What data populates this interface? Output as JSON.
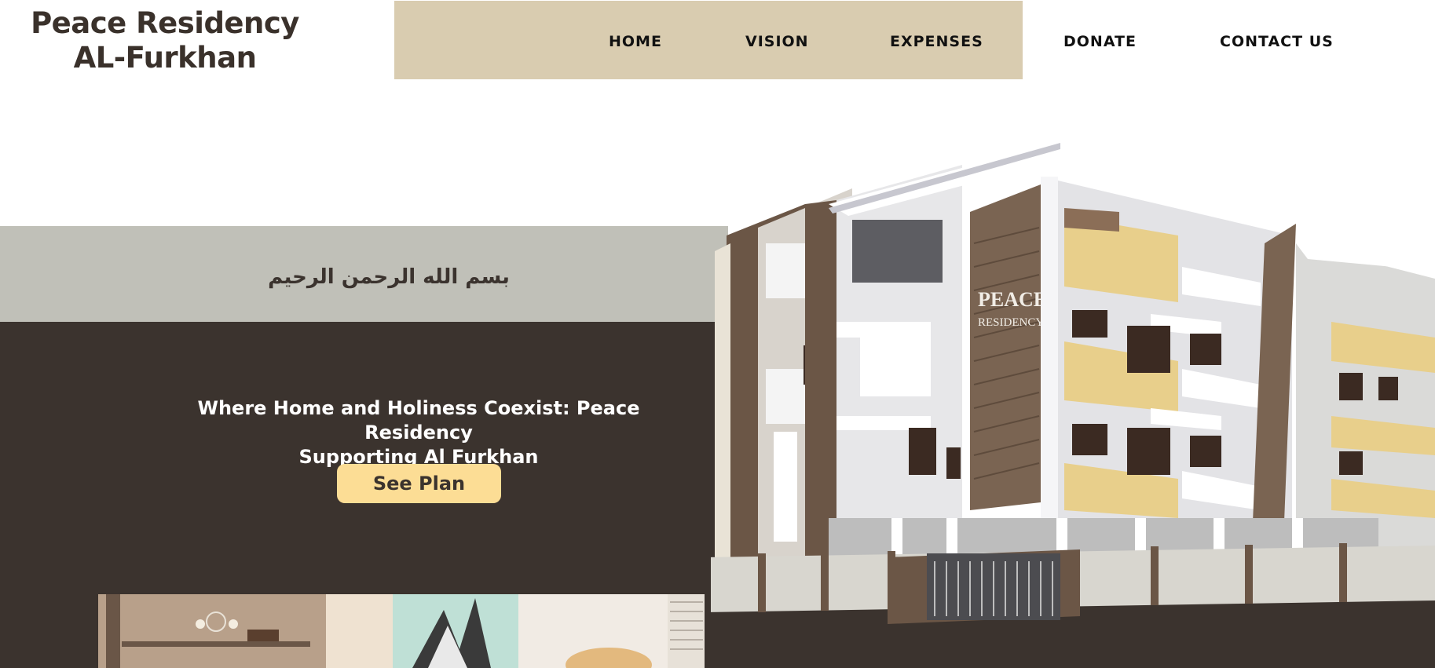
{
  "header": {
    "logo_line1": "Peace Residency",
    "logo_line2": "AL-Furkhan"
  },
  "nav": {
    "items": [
      {
        "label": "HOME"
      },
      {
        "label": "VISION"
      },
      {
        "label": "EXPENSES"
      },
      {
        "label": "DONATE"
      },
      {
        "label": "CONTACT US"
      }
    ]
  },
  "hero": {
    "bismillah": "بسم الله الرحمن الرحيم",
    "tagline_line1": "Where Home and Holiness Coexist: Peace Residency",
    "tagline_line2": "Supporting Al Furkhan",
    "cta_label": "See Plan"
  },
  "building_image": {
    "sign_line1": "PEACE",
    "sign_line2": "RESIDENCY"
  },
  "colors": {
    "dark_brown": "#3b332e",
    "nav_band": "#d9ccb0",
    "bismillah_bar": "#c0c0b8",
    "cta": "#fcdd95",
    "balcony_yellow": "#e8cf8b"
  }
}
